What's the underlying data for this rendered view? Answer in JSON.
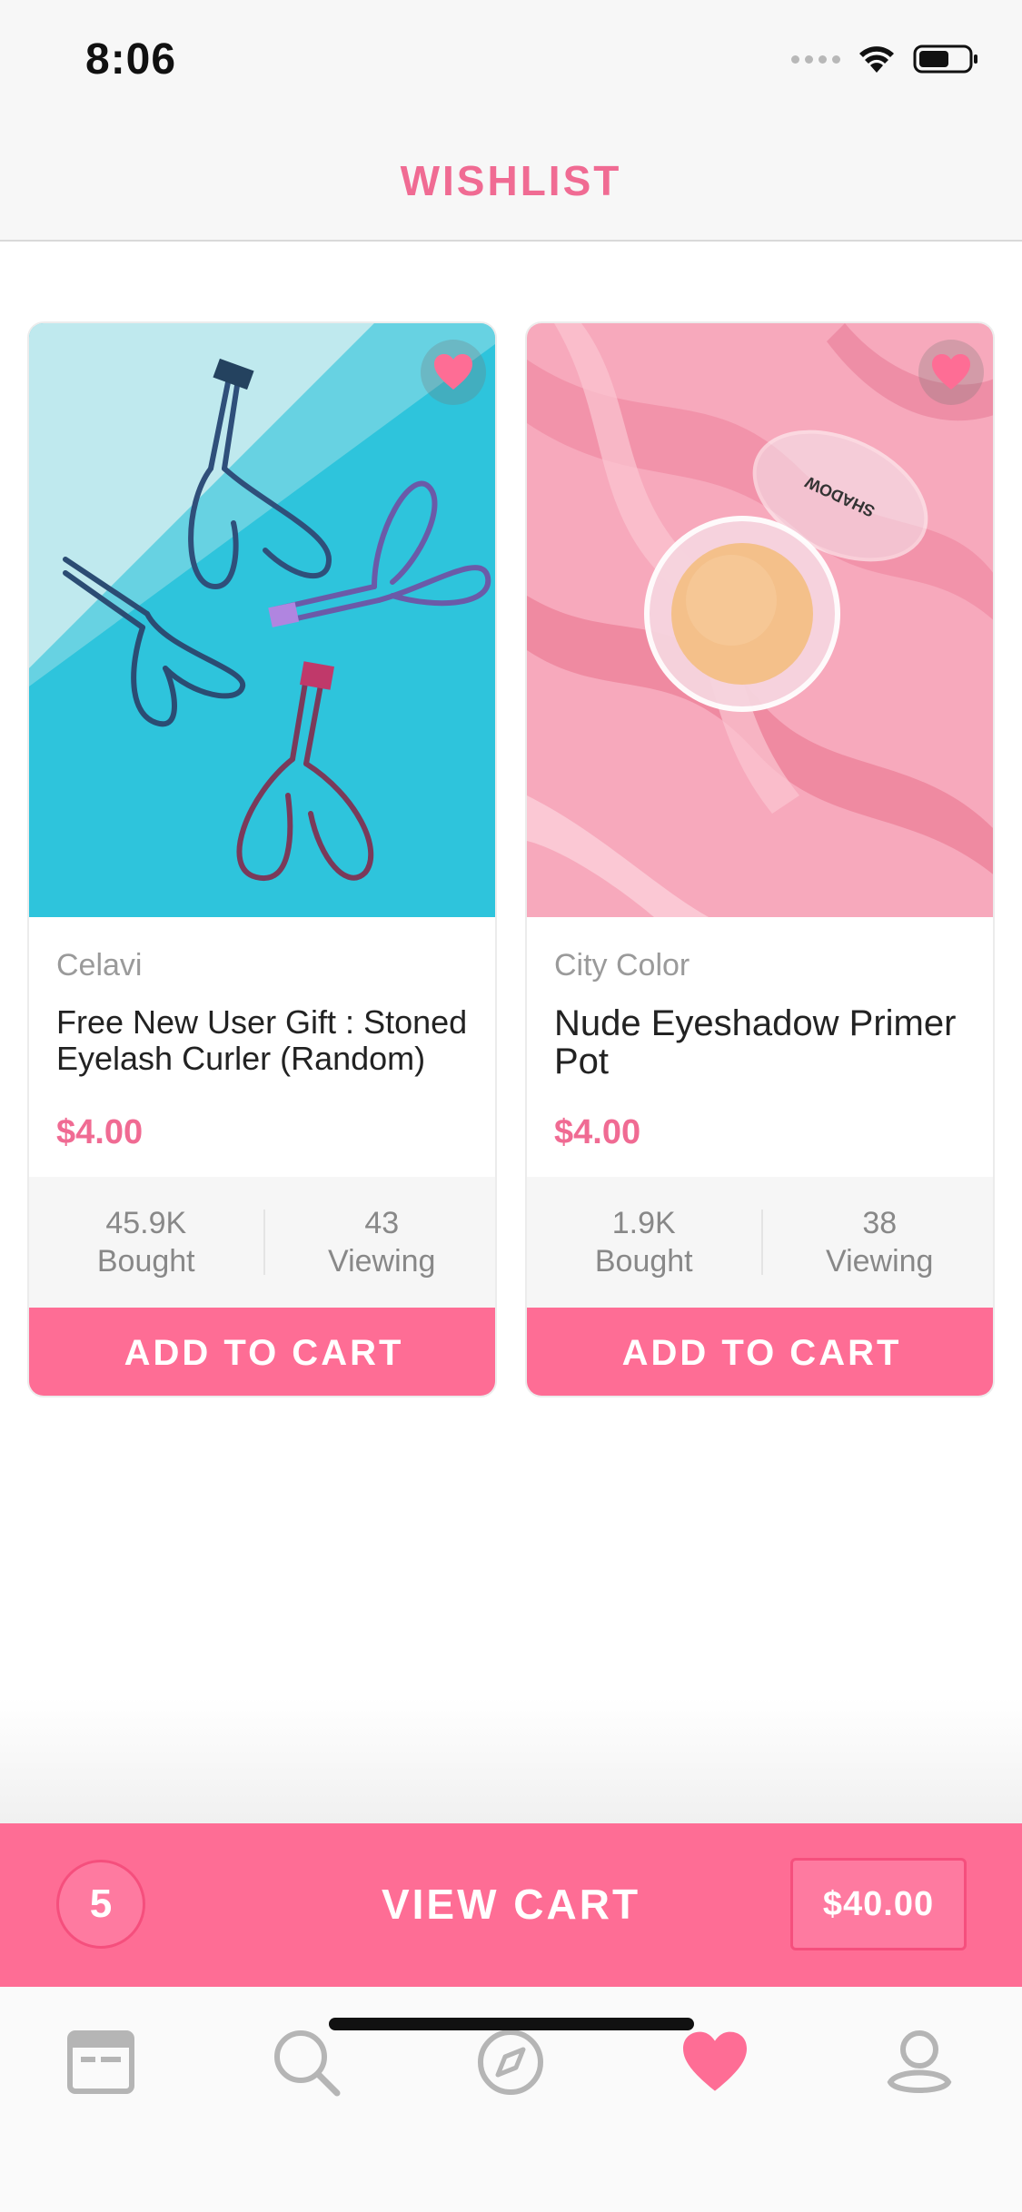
{
  "status_bar": {
    "time": "8:06"
  },
  "header": {
    "title": "WISHLIST"
  },
  "products": [
    {
      "brand": "Celavi",
      "name": "Free New User Gift : Stoned Eyelash Curler (Random)",
      "price": "$4.00",
      "bought_value": "45.9K",
      "bought_label": "Bought",
      "viewing_value": "43",
      "viewing_label": "Viewing",
      "button_label": "ADD TO CART",
      "favorited": true
    },
    {
      "brand": "City Color",
      "name": "Nude Eyeshadow Primer Pot",
      "price": "$4.00",
      "bought_value": "1.9K",
      "bought_label": "Bought",
      "viewing_value": "38",
      "viewing_label": "Viewing",
      "button_label": "ADD TO CART",
      "favorited": true
    }
  ],
  "cart_bar": {
    "count": "5",
    "label": "VIEW CART",
    "total": "$40.00"
  },
  "tab_bar": {
    "items": [
      {
        "icon": "news-icon",
        "active": false
      },
      {
        "icon": "search-icon",
        "active": false
      },
      {
        "icon": "compass-icon",
        "active": false
      },
      {
        "icon": "heart-icon",
        "active": true
      },
      {
        "icon": "profile-icon",
        "active": false
      }
    ]
  },
  "colors": {
    "accent": "#fe6d95",
    "title_pink": "#f06b93",
    "inactive_icon": "#b5b5b5"
  }
}
